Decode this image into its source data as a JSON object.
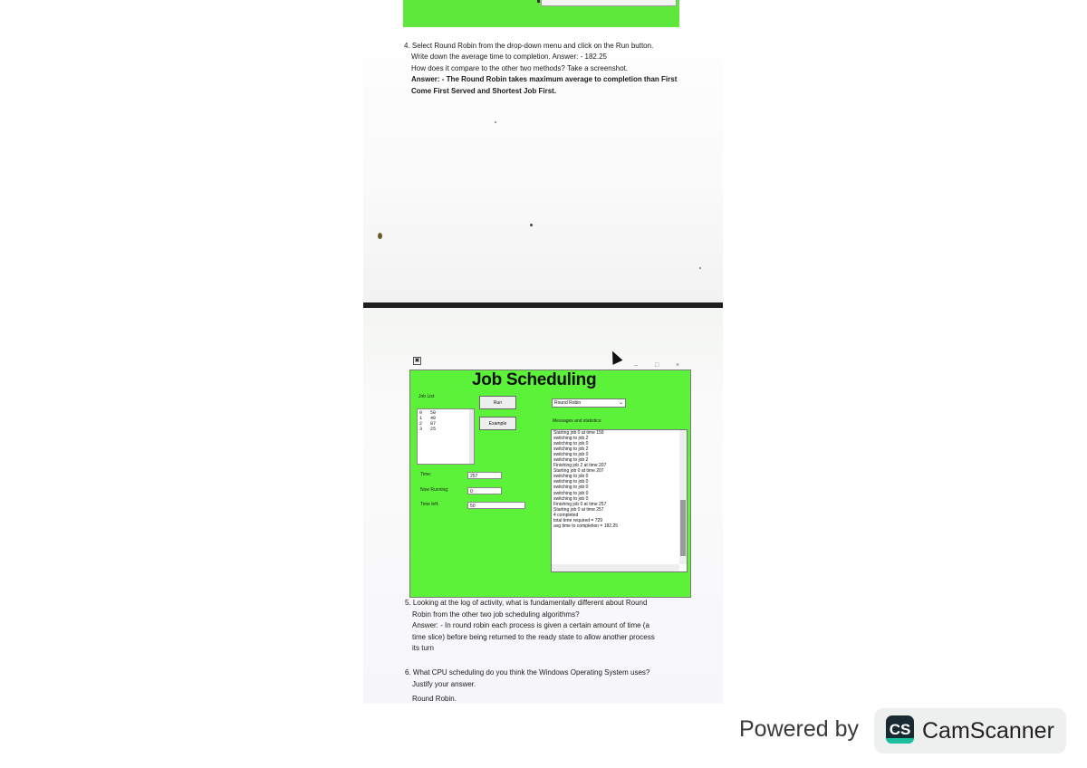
{
  "page1": {
    "q4": {
      "number": "4.",
      "line1": "Select Round Robin from the drop-down menu and click on the Run button.",
      "line2": "Write down the average time to completion.  Answer: - 182.25",
      "line3": "How does it compare to the other two methods? Take a screenshot.",
      "line4": "Answer: - The Round Robin takes maximum average to completion than First",
      "line5": "Come First Served and Shortest Job First."
    }
  },
  "app": {
    "title": "Job Scheduling",
    "job_list_label": "Job List",
    "jobs": [
      "0   50",
      "1   40",
      "2   87",
      "3   25"
    ],
    "run_button": "Run",
    "example_button": "Example",
    "algorithm_selected": "Round Robin",
    "messages_label": "Messages and statistics:",
    "time_label": "Time:",
    "time_value": "257",
    "now_running_label": "Now Running:",
    "now_running_value": "0",
    "time_left_label": "Time left:",
    "time_left_value": "50",
    "messages": [
      "Starting job 0 at time 159",
      "switching to job 2",
      "switching to job 0",
      "switching to job 2",
      "switching to job 0",
      "switching to job 2",
      "Finishing job 2 at time 207",
      "Starting job 0 at time 207",
      "switching to job 0",
      "switching to job 0",
      "switching to job 0",
      "switching to job 0",
      "switching to job 0",
      "Finishing job 0 at time 257",
      "Starting job 0 at time 257",
      "4 completed",
      "total time required = 729",
      "avg time to completion = 182.25"
    ]
  },
  "page2": {
    "q5": {
      "number": "5.",
      "line1": "Looking at the log of activity, what is fundamentally different about Round",
      "line2": "Robin from the other two job scheduling algorithms?",
      "line3": "Answer: - In round robin each process is given a certain amount of time (a",
      "line4": "time slice) before being returned to the ready state to allow another process",
      "line5": "its turn"
    },
    "q6": {
      "number": "6.",
      "line1": "What CPU scheduling do you think the Windows Operating System uses?",
      "line2": "Justify your answer."
    },
    "q6_answer": "Round Robin."
  },
  "footer": {
    "powered_by": "Powered by",
    "brand_logo": "CS",
    "brand_name": "CamScanner",
    "brand_colors": {
      "logo_bg": "#1a2a33",
      "logo_accent": "#1bbfa0"
    }
  }
}
